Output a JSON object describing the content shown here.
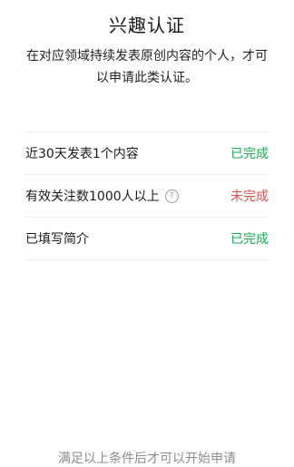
{
  "header": {
    "title": "兴趣认证",
    "description": "在对应领域持续发表原创内容的个人，才可以申请此类认证。"
  },
  "requirements": [
    {
      "label": "近30天发表1个内容",
      "status": "已完成",
      "has_help_icon": false
    },
    {
      "label": "有效关注数1000人以上",
      "status": "未完成",
      "has_help_icon": true
    },
    {
      "label": "已填写简介",
      "status": "已完成",
      "has_help_icon": false
    }
  ],
  "footer": {
    "hint": "满足以上条件后才可以开始申请"
  },
  "icons": {
    "help": "question-circle-icon"
  },
  "colors": {
    "done": "#1aad52",
    "pending": "#e0504f",
    "hint": "#8c8c8c"
  }
}
